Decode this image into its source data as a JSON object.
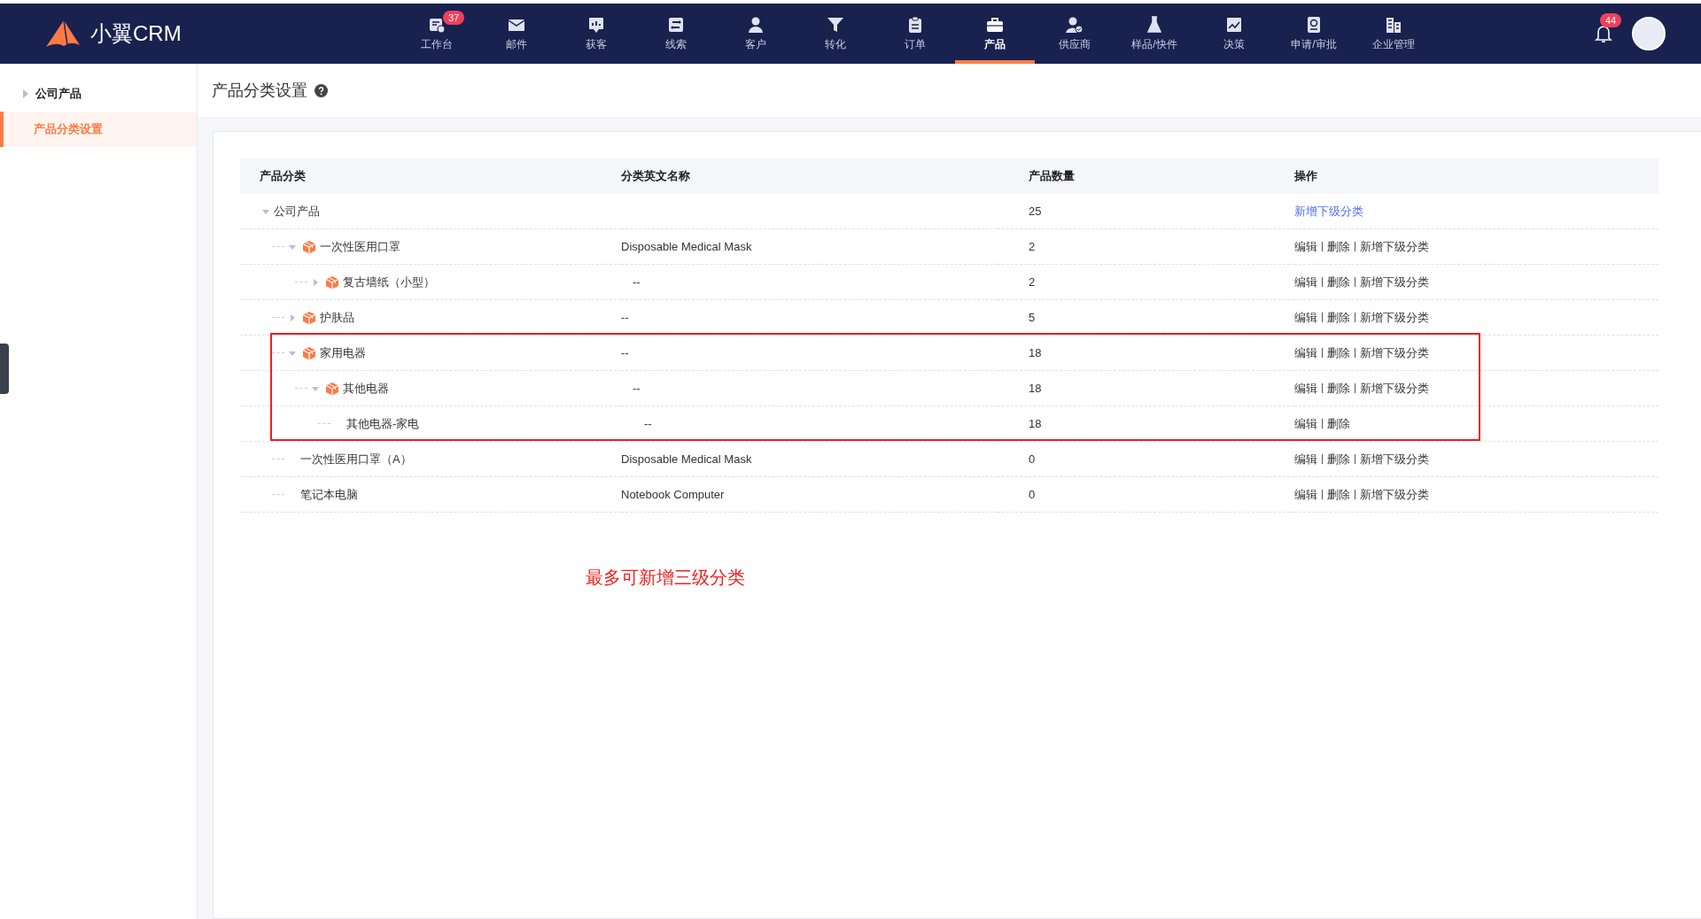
{
  "brand": {
    "name": "小翼CRM"
  },
  "nav": [
    {
      "label": "工作台",
      "selected": false,
      "badge": "37"
    },
    {
      "label": "邮件",
      "selected": false
    },
    {
      "label": "获客",
      "selected": false
    },
    {
      "label": "线索",
      "selected": false
    },
    {
      "label": "客户",
      "selected": false
    },
    {
      "label": "转化",
      "selected": false
    },
    {
      "label": "订单",
      "selected": false
    },
    {
      "label": "产品",
      "selected": true
    },
    {
      "label": "供应商",
      "selected": false
    },
    {
      "label": "样品/快件",
      "selected": false
    },
    {
      "label": "决策",
      "selected": false
    },
    {
      "label": "申请/审批",
      "selected": false
    },
    {
      "label": "企业管理",
      "selected": false
    }
  ],
  "notifications": {
    "badge": "44"
  },
  "sidebar": {
    "items": [
      {
        "label": "公司产品",
        "kind": "group",
        "selected": false
      },
      {
        "label": "产品分类设置",
        "kind": "page",
        "selected": true
      }
    ]
  },
  "page": {
    "title": "产品分类设置"
  },
  "table": {
    "columns": [
      "产品分类",
      "分类英文名称",
      "产品数量",
      "操作"
    ],
    "rows": [
      {
        "name": "公司产品",
        "en_name": "",
        "count": "25",
        "kind": "folder",
        "expanded": true,
        "cube": false,
        "highlighted": false,
        "actions": [
          {
            "label": "新增下级分类",
            "kind": "link"
          }
        ],
        "children": [
          {
            "name": "一次性医用口罩",
            "en_name": "Disposable Medical Mask",
            "count": "2",
            "kind": "folder",
            "expanded": true,
            "cube": true,
            "highlighted": false,
            "actions": [
              {
                "label": "编辑",
                "kind": "text"
              },
              {
                "label": "删除",
                "kind": "text"
              },
              {
                "label": "新增下级分类",
                "kind": "text"
              }
            ],
            "children": [
              {
                "name": "复古墙纸（小型）",
                "en_name": "--",
                "count": "2",
                "kind": "folder",
                "expanded": false,
                "cube": true,
                "highlighted": false,
                "actions": [
                  {
                    "label": "编辑",
                    "kind": "text"
                  },
                  {
                    "label": "删除",
                    "kind": "text"
                  },
                  {
                    "label": "新增下级分类",
                    "kind": "text"
                  }
                ]
              }
            ]
          },
          {
            "name": "护肤品",
            "en_name": "--",
            "count": "5",
            "kind": "folder",
            "expanded": false,
            "cube": true,
            "highlighted": false,
            "actions": [
              {
                "label": "编辑",
                "kind": "text"
              },
              {
                "label": "删除",
                "kind": "text"
              },
              {
                "label": "新增下级分类",
                "kind": "text"
              }
            ]
          },
          {
            "name": "家用电器",
            "en_name": "--",
            "count": "18",
            "kind": "folder",
            "expanded": true,
            "cube": true,
            "highlighted": true,
            "actions": [
              {
                "label": "编辑",
                "kind": "text"
              },
              {
                "label": "删除",
                "kind": "text"
              },
              {
                "label": "新增下级分类",
                "kind": "text"
              }
            ],
            "children": [
              {
                "name": "其他电器",
                "en_name": "--",
                "count": "18",
                "kind": "folder",
                "expanded": true,
                "cube": true,
                "highlighted": false,
                "actions": [
                  {
                    "label": "编辑",
                    "kind": "text"
                  },
                  {
                    "label": "删除",
                    "kind": "text"
                  },
                  {
                    "label": "新增下级分类",
                    "kind": "text"
                  }
                ],
                "children": [
                  {
                    "name": "其他电器-家电",
                    "en_name": "--",
                    "count": "18",
                    "kind": "leaf",
                    "cube": false,
                    "highlighted": false,
                    "actions": [
                      {
                        "label": "编辑",
                        "kind": "text"
                      },
                      {
                        "label": "删除",
                        "kind": "text"
                      }
                    ]
                  }
                ]
              }
            ]
          },
          {
            "name": "一次性医用口罩（A）",
            "en_name": "Disposable Medical Mask",
            "count": "0",
            "kind": "leaf",
            "cube": false,
            "highlighted": false,
            "actions": [
              {
                "label": "编辑",
                "kind": "text"
              },
              {
                "label": "删除",
                "kind": "text"
              },
              {
                "label": "新增下级分类",
                "kind": "text"
              }
            ]
          },
          {
            "name": "笔记本电脑",
            "en_name": "Notebook Computer",
            "count": "0",
            "kind": "leaf",
            "cube": false,
            "highlighted": false,
            "actions": [
              {
                "label": "编辑",
                "kind": "text"
              },
              {
                "label": "删除",
                "kind": "text"
              },
              {
                "label": "新增下级分类",
                "kind": "text"
              }
            ]
          }
        ]
      }
    ]
  },
  "note": "最多可新增三级分类"
}
